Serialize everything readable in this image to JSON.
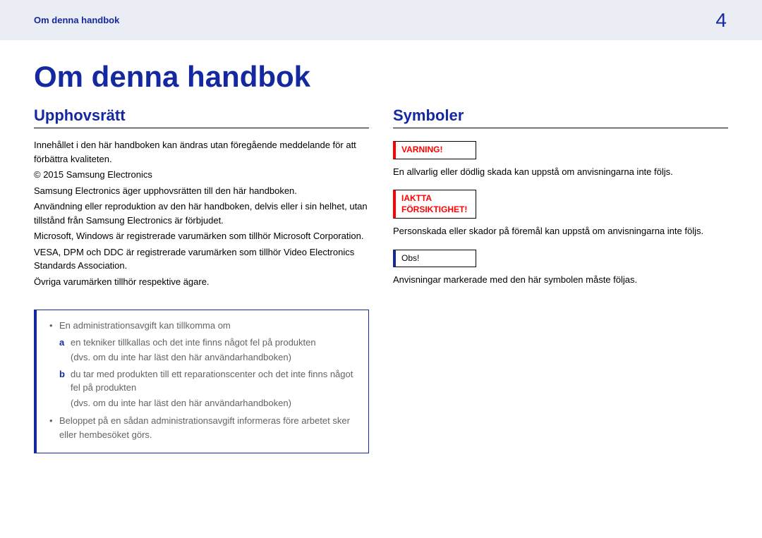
{
  "header": {
    "crumb": "Om denna handbok",
    "page_no": "4"
  },
  "title": "Om denna handbok",
  "left": {
    "heading": "Upphovsrätt",
    "p1": "Innehållet i den här handboken kan ändras utan föregående meddelande för att förbättra kvaliteten.",
    "p2": "© 2015 Samsung Electronics",
    "p3": "Samsung Electronics äger upphovsrätten till den här handboken.",
    "p4": "Användning eller reproduktion av den här handboken, delvis eller i sin helhet, utan tillstånd från Samsung Electronics är förbjudet.",
    "p5": "Microsoft, Windows är registrerade varumärken som tillhör Microsoft Corporation.",
    "p6": "VESA, DPM och DDC är registrerade varumärken som tillhör Video Electronics Standards Association.",
    "p7": "Övriga varumärken tillhör respektive ägare.",
    "note": {
      "b1": "En administrationsavgift kan tillkomma om",
      "a_letter": "a",
      "a1": "en tekniker tillkallas och det inte finns något fel på produkten",
      "a2": "(dvs. om du inte har läst den här användarhandboken)",
      "b_letter": "b",
      "bb1": "du tar med produkten till ett reparationscenter och det inte finns något fel på produkten",
      "bb2": "(dvs. om du inte har läst den här användarhandboken)",
      "b2": "Beloppet på en sådan administrationsavgift informeras före arbetet sker eller hembesöket görs."
    }
  },
  "right": {
    "heading": "Symboler",
    "warn_label": "VARNING!",
    "warn_desc": "En allvarlig eller dödlig skada kan uppstå om anvisningarna inte följs.",
    "caution_l1": "IAKTTA",
    "caution_l2": "FÖRSIKTIGHET!",
    "caution_desc": "Personskada eller skador på föremål kan uppstå om anvisningarna inte följs.",
    "obs_label": "Obs!",
    "obs_desc": "Anvisningar markerade med den här symbolen måste följas."
  }
}
